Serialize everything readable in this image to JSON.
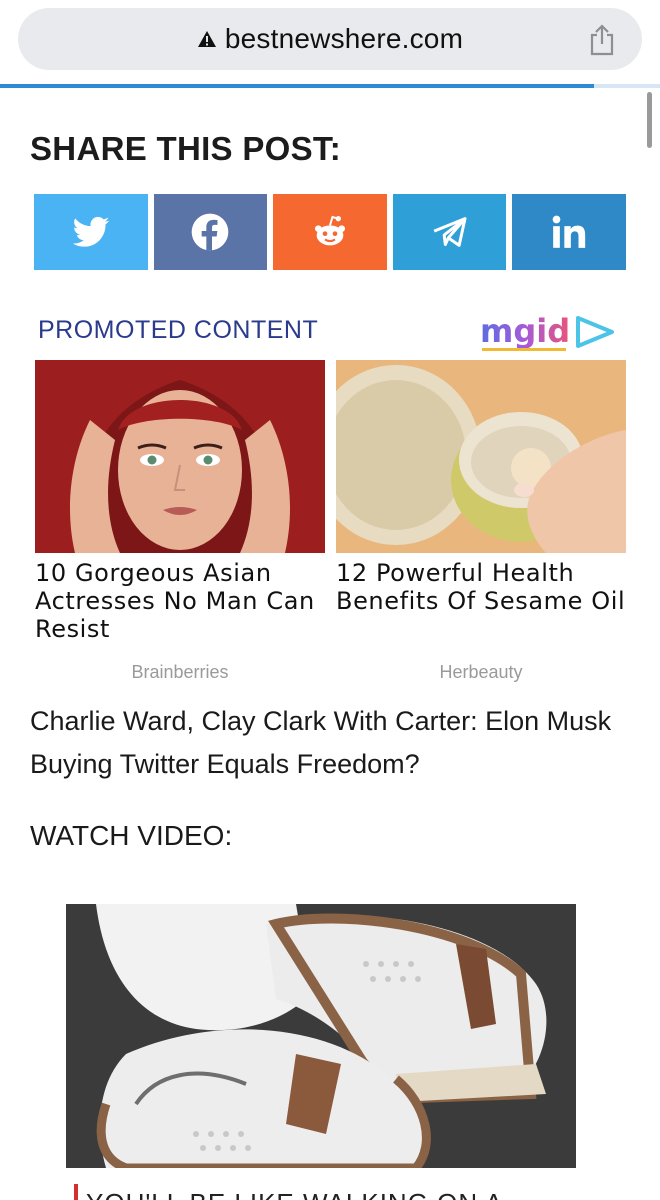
{
  "browser": {
    "url": "bestnewshere.com",
    "security_icon": "warning-triangle-icon",
    "share_icon": "share-icon",
    "load_progress": 0.9
  },
  "share": {
    "title": "SHARE THIS POST:",
    "buttons": [
      {
        "network": "twitter",
        "icon": "twitter-icon",
        "color": "#4ab3f4"
      },
      {
        "network": "facebook",
        "icon": "facebook-icon",
        "color": "#5b74a8"
      },
      {
        "network": "reddit",
        "icon": "reddit-icon",
        "color": "#f5682f"
      },
      {
        "network": "telegram",
        "icon": "telegram-icon",
        "color": "#2f9fd8"
      },
      {
        "network": "linkedin",
        "icon": "linkedin-icon",
        "color": "#2e89c6"
      }
    ]
  },
  "promoted": {
    "label": "PROMOTED CONTENT",
    "logo_text": "mgid",
    "cards": [
      {
        "title": "10 Gorgeous Asian Actresses No Man Can Resist",
        "source": "Brainberries"
      },
      {
        "title": "12 Powerful Health Benefits Of Sesame Oil",
        "source": "Herbeauty"
      }
    ]
  },
  "article": {
    "headline": "Charlie Ward, Clay Clark With Carter: Elon Musk Buying Twitter Equals Freedom?",
    "watch_label": "WATCH VIDEO:",
    "caption": "YOU'LL BE LIKE WALKING ON A"
  },
  "colors": {
    "accent_blue": "#2f8ad6",
    "promo_label": "#2a3a8c",
    "caption_bar": "#d32f2f"
  }
}
